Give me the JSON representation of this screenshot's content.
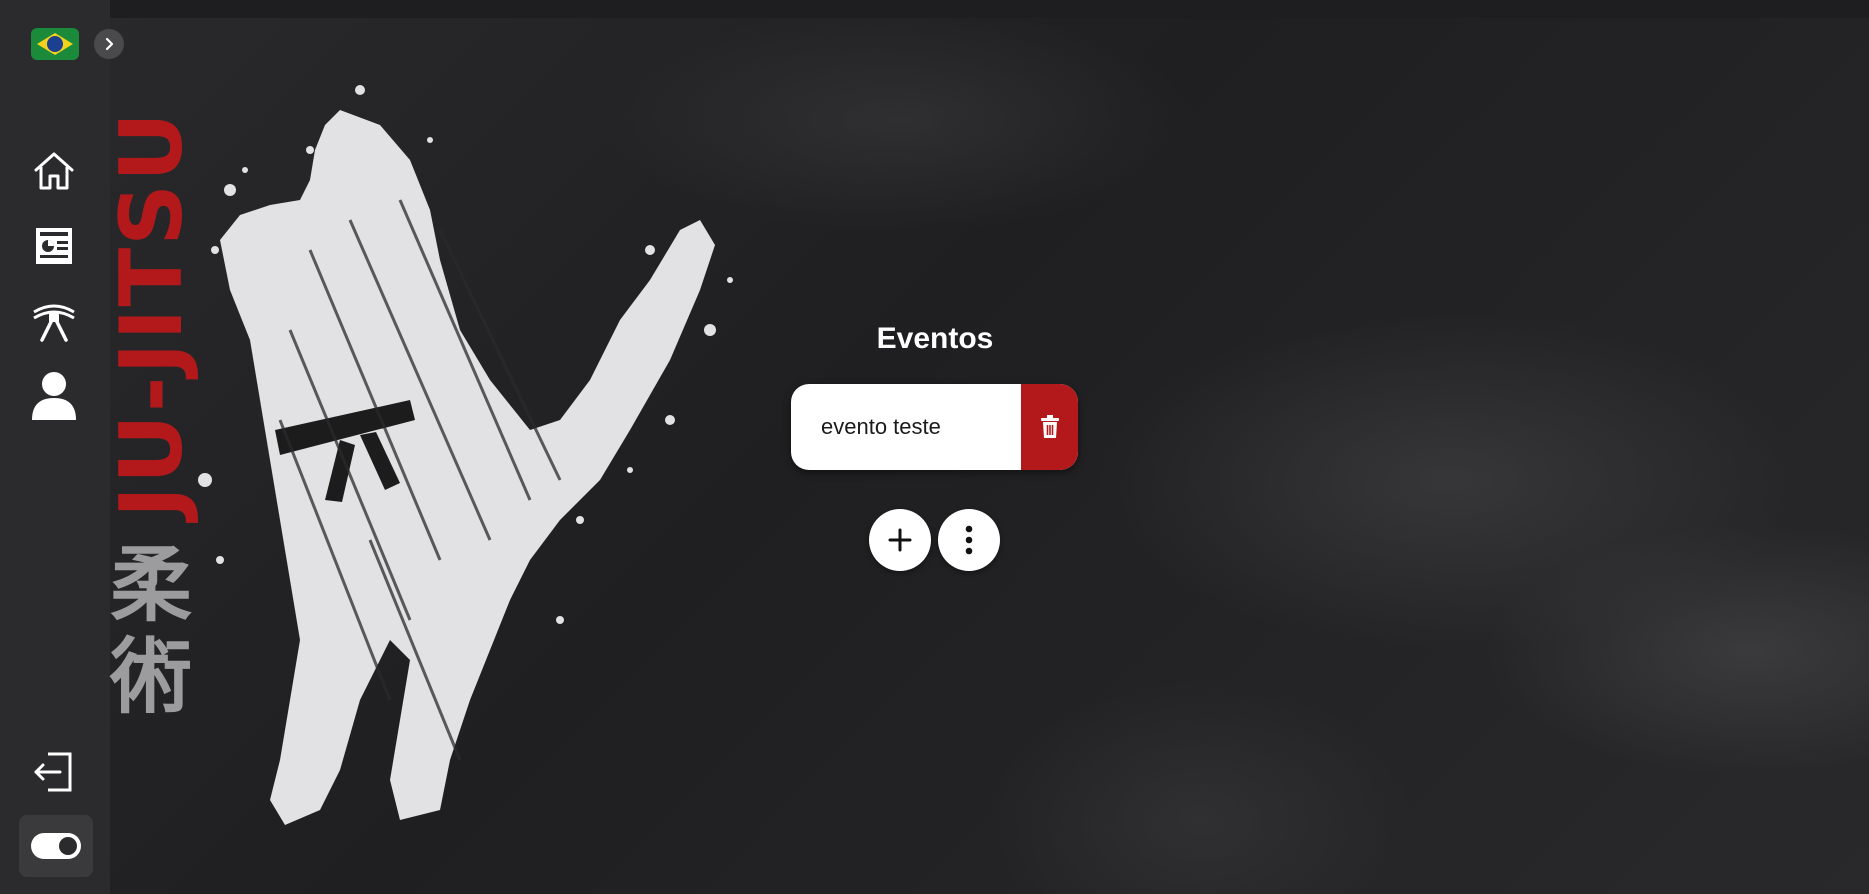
{
  "sidebar": {
    "language_flag": "brazil-flag",
    "expand_icon": "chevron-right-icon",
    "items": [
      {
        "icon": "home-icon"
      },
      {
        "icon": "newspaper-icon"
      },
      {
        "icon": "belt-icon"
      },
      {
        "icon": "user-icon"
      }
    ],
    "logout_icon": "logout-icon",
    "theme_toggle_icon": "toggle-icon"
  },
  "hero": {
    "vertical_text": "JU-JITSU",
    "kanji": "柔術"
  },
  "main": {
    "title": "Eventos",
    "events": [
      {
        "name": "evento teste",
        "delete_icon": "trash-icon"
      }
    ],
    "add_icon": "plus-icon",
    "more_icon": "more-vertical-icon"
  },
  "colors": {
    "accent_red": "#b3191b",
    "sidebar_bg": "#2b2b2d",
    "page_bg": "#242426"
  }
}
